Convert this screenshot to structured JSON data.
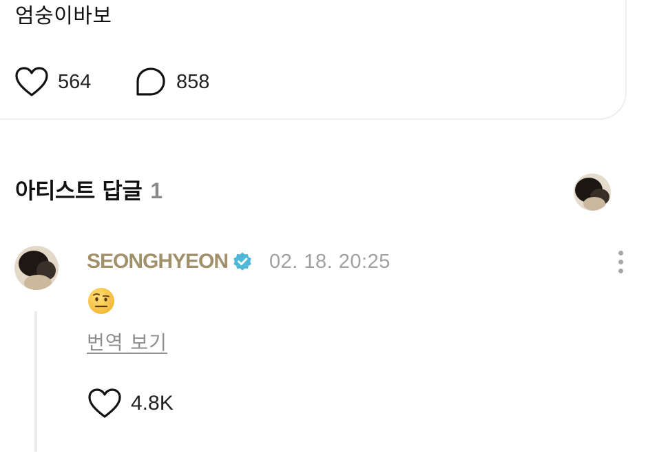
{
  "post": {
    "text": "엄숭이바보",
    "likes": "564",
    "comments": "858"
  },
  "artist_replies": {
    "title": "아티스트 답글",
    "count": "1"
  },
  "comment": {
    "author": "SEONGHYEON",
    "verified": true,
    "timestamp": "02. 18. 20:25",
    "content_emoji": "raised-eyebrow-face",
    "translate_label": "번역 보기",
    "likes": "4.8K"
  },
  "colors": {
    "author": "#a1916a",
    "verified": "#4fb8d8",
    "muted": "#8e8e8e",
    "emoji": "#f7c23a"
  },
  "icons": {
    "like": "heart-icon",
    "comment": "comment-bubble-icon",
    "verified": "verified-badge-icon",
    "more": "more-vertical-icon"
  }
}
